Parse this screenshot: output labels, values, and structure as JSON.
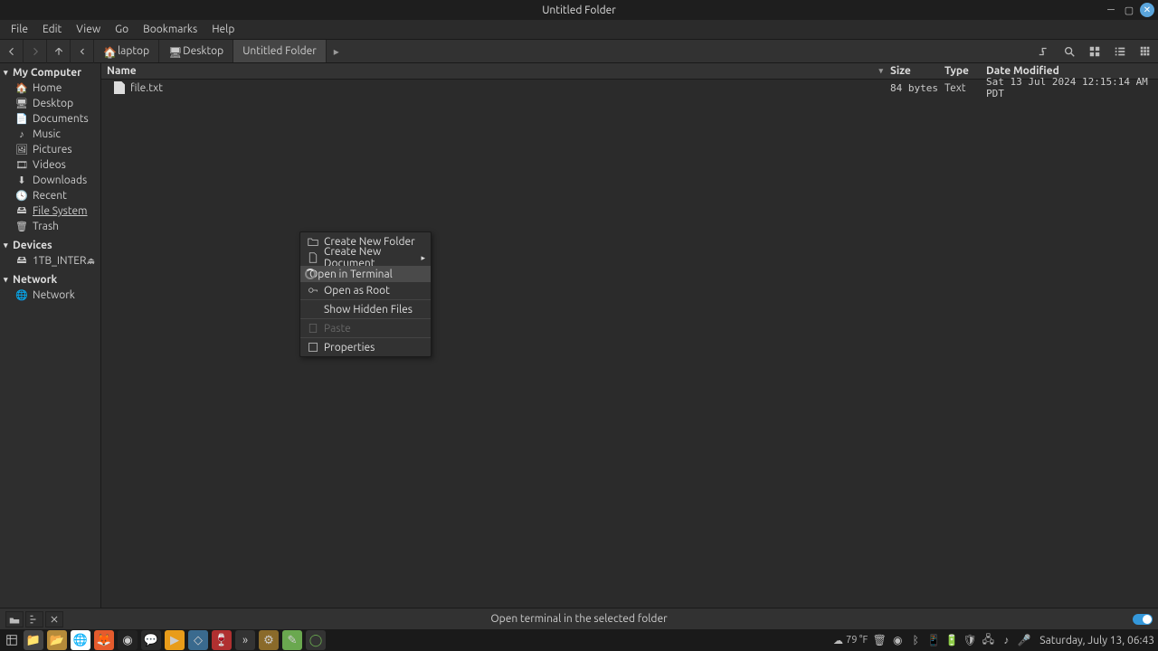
{
  "window": {
    "title": "Untitled Folder"
  },
  "menubar": [
    "File",
    "Edit",
    "View",
    "Go",
    "Bookmarks",
    "Help"
  ],
  "breadcrumb": {
    "items": [
      {
        "label": "laptop",
        "icon": "home"
      },
      {
        "label": "Desktop",
        "icon": "desktop"
      },
      {
        "label": "Untitled Folder",
        "icon": "",
        "active": true
      }
    ]
  },
  "sidebar": {
    "groups": [
      {
        "label": "My Computer",
        "items": [
          {
            "label": "Home",
            "icon": "🏠"
          },
          {
            "label": "Desktop",
            "icon": "🖥"
          },
          {
            "label": "Documents",
            "icon": "📄"
          },
          {
            "label": "Music",
            "icon": "♪"
          },
          {
            "label": "Pictures",
            "icon": "🖼"
          },
          {
            "label": "Videos",
            "icon": "🎞"
          },
          {
            "label": "Downloads",
            "icon": "⬇"
          },
          {
            "label": "Recent",
            "icon": "🕓"
          },
          {
            "label": "File System",
            "icon": "🖴",
            "underline": true
          },
          {
            "label": "Trash",
            "icon": "🗑"
          }
        ]
      },
      {
        "label": "Devices",
        "items": [
          {
            "label": "1TB_INTER...",
            "icon": "🖴",
            "eject": true
          }
        ]
      },
      {
        "label": "Network",
        "items": [
          {
            "label": "Network",
            "icon": "🌐"
          }
        ]
      }
    ]
  },
  "columns": {
    "name": "Name",
    "size": "Size",
    "type": "Type",
    "date": "Date Modified"
  },
  "files": [
    {
      "name": "file.txt",
      "size": "84 bytes",
      "type": "Text",
      "date": "Sat 13 Jul 2024 12:15:14 AM PDT"
    }
  ],
  "context_menu": {
    "items": [
      {
        "label": "Create New Folder",
        "icon": "folder-plus"
      },
      {
        "label": "Create New Document",
        "icon": "doc-plus",
        "submenu": true
      },
      {
        "label": "Open in Terminal",
        "icon": "terminal",
        "highlighted": true
      },
      {
        "label": "Open as Root",
        "icon": "key"
      },
      {
        "separator": true
      },
      {
        "label": "Show Hidden Files",
        "icon": ""
      },
      {
        "separator": true
      },
      {
        "label": "Paste",
        "icon": "paste",
        "disabled": true
      },
      {
        "separator": true
      },
      {
        "label": "Properties",
        "icon": "props"
      }
    ]
  },
  "statusbar": {
    "text": "Open terminal in the selected folder"
  },
  "taskbar": {
    "weather": "79 °F",
    "clock": "Saturday, July 13, 06:43"
  }
}
